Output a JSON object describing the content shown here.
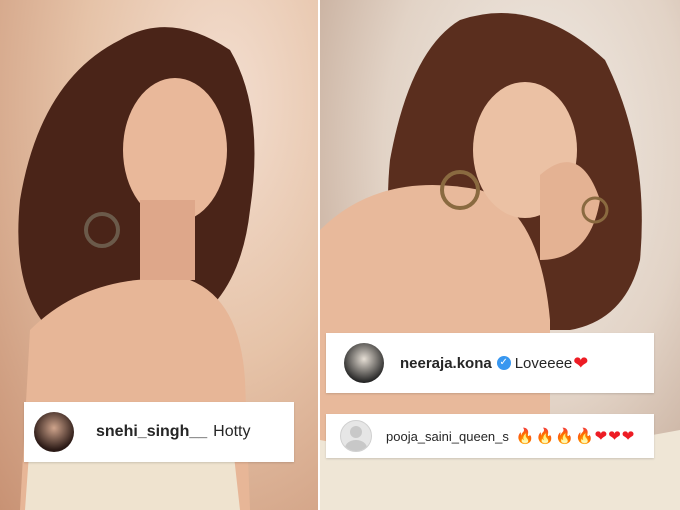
{
  "comments": [
    {
      "username": "snehi_singh__",
      "text": "Hotty"
    },
    {
      "username": "neeraja.kona",
      "text": "Loveeee",
      "emoji": "❤"
    },
    {
      "username": "pooja_saini_queen_s",
      "emojis": [
        "🔥",
        "🔥",
        "🔥",
        "🔥",
        "❤",
        "❤",
        "❤"
      ]
    }
  ],
  "colors": {
    "heart": "#ed1c24",
    "verified": "#3897f0"
  }
}
